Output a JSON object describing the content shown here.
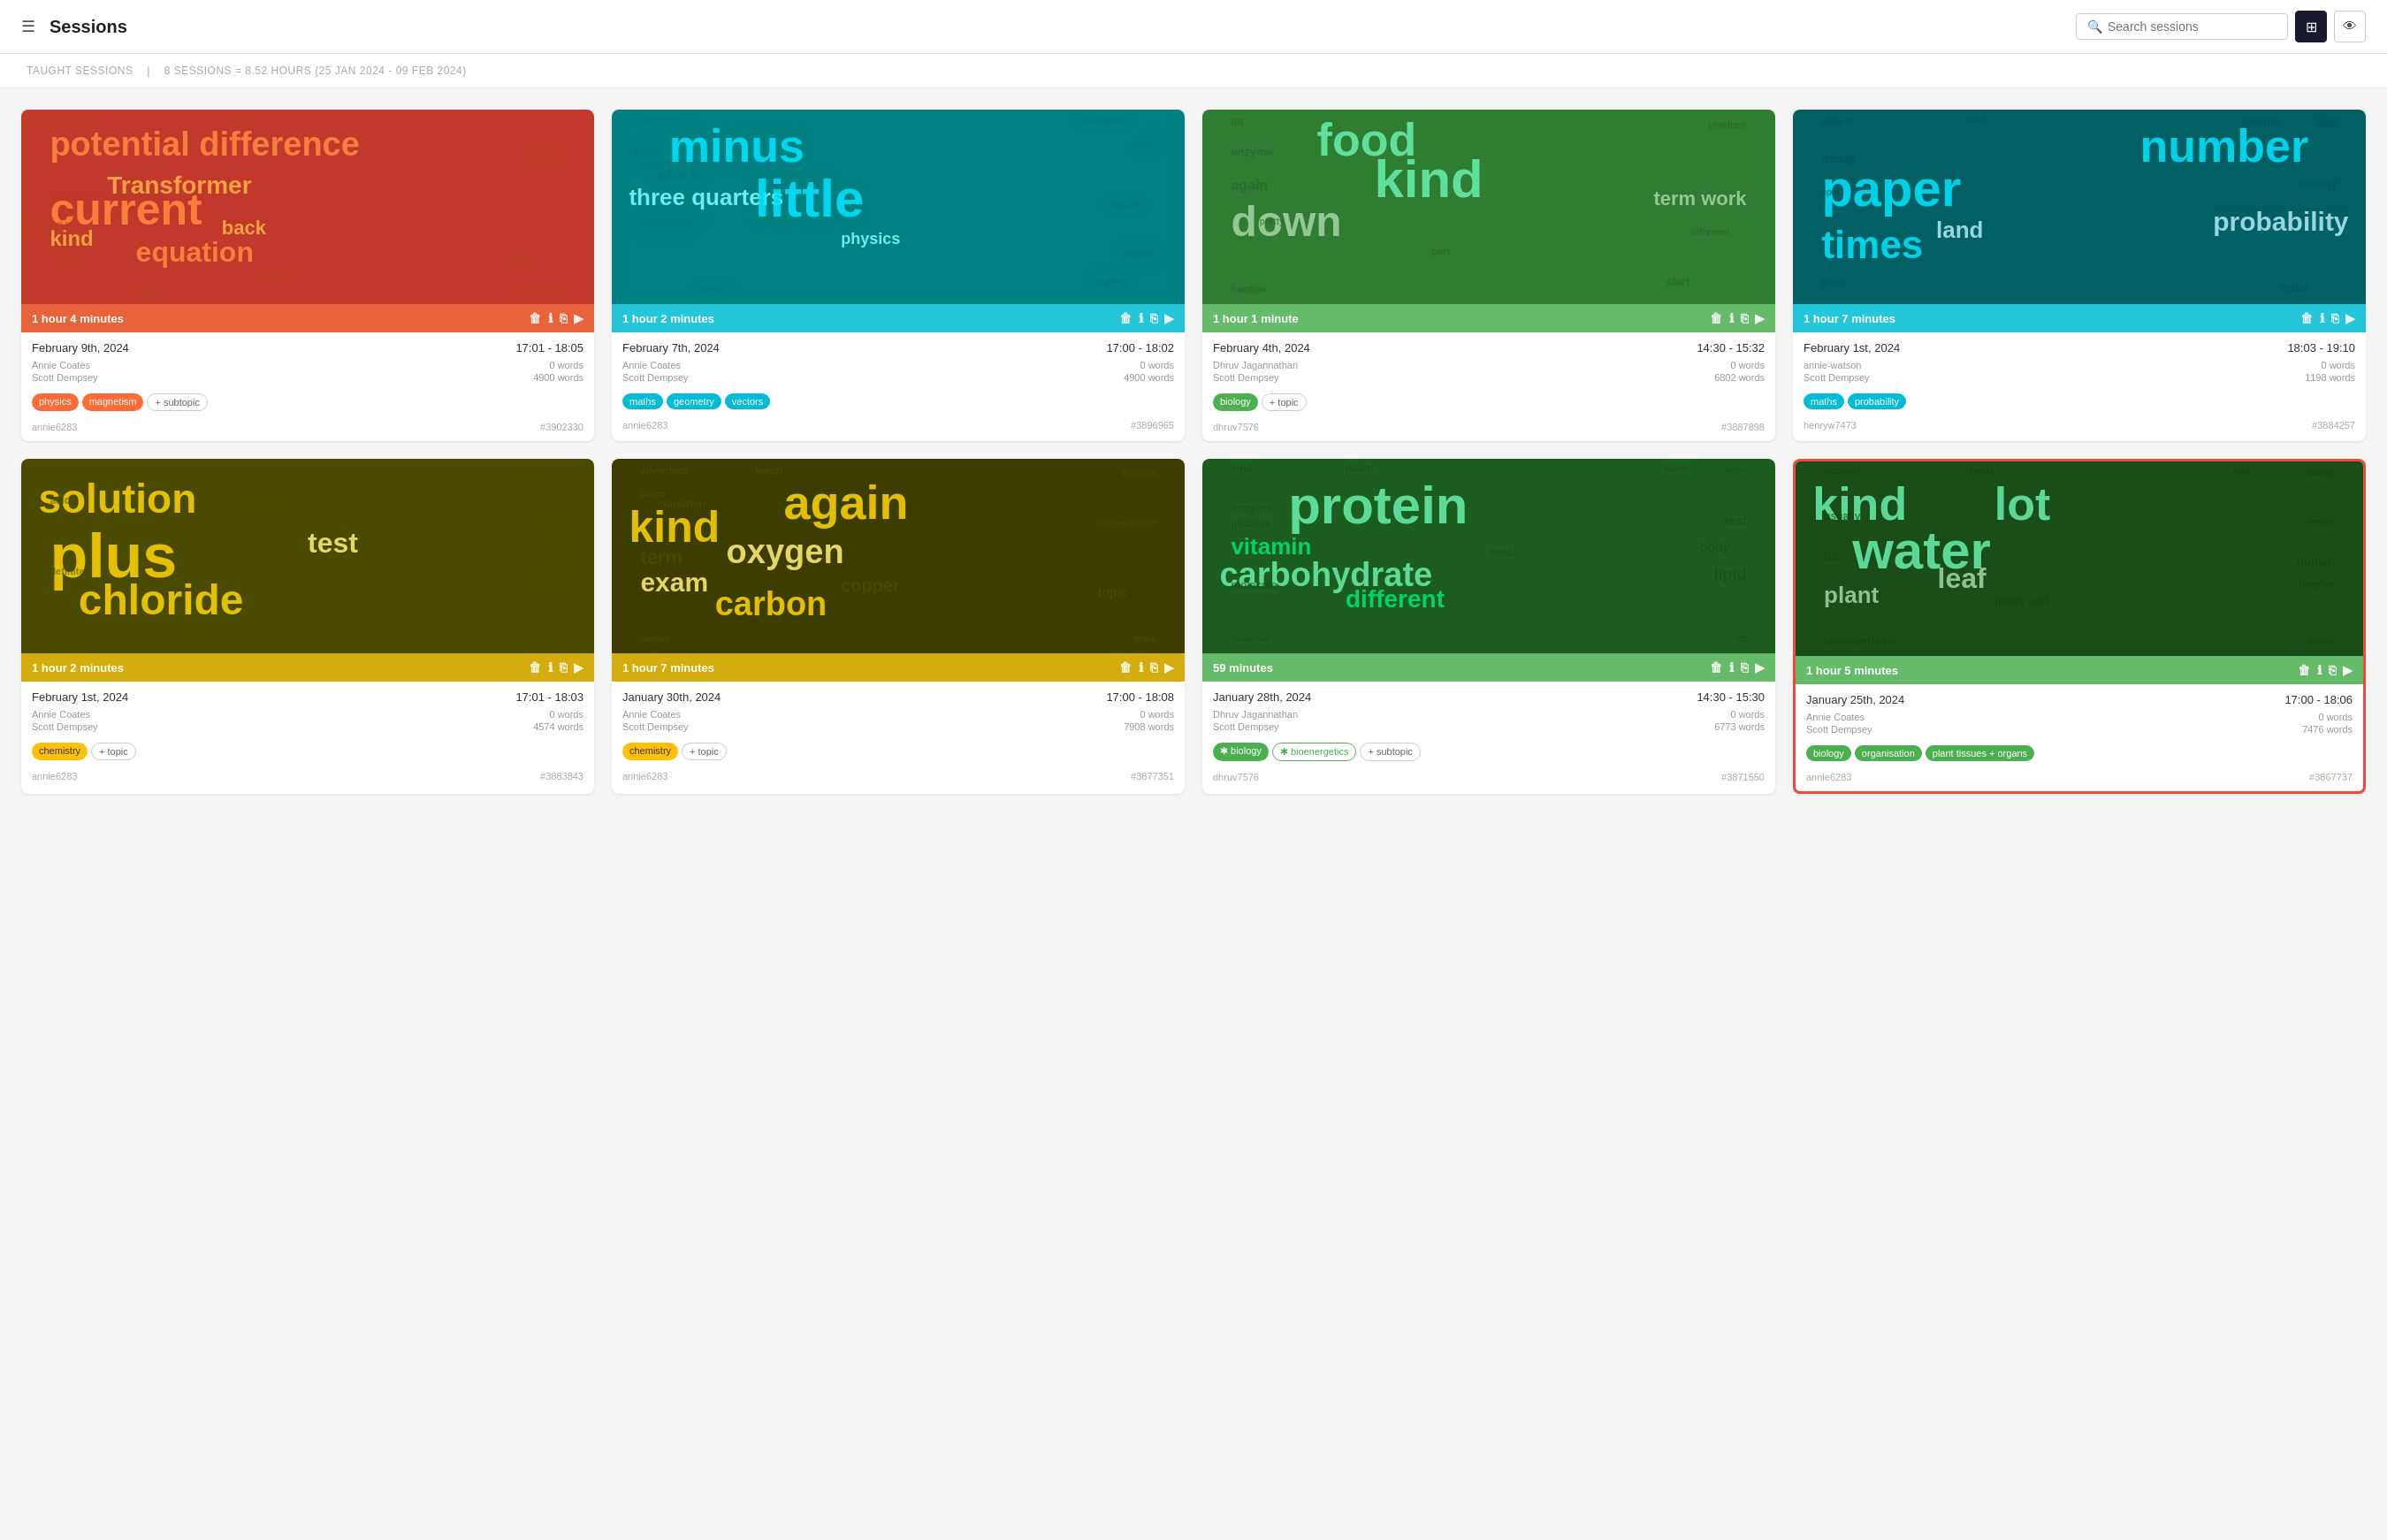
{
  "header": {
    "menu_label": "☰",
    "title": "Sessions",
    "search_placeholder": "Search sessions"
  },
  "subheader": {
    "label": "TAUGHT SESSIONS",
    "separator": "|",
    "stats": "8 SESSIONS = 8.52 HOURS (25 JAN 2024 - 09 FEB 2024)"
  },
  "sessions": [
    {
      "id": 1,
      "duration": "1 hour 4 minutes",
      "date": "February 9th, 2024",
      "time": "17:01 - 18:05",
      "teacher": "Annie Coates",
      "student": "Scott Dempsey",
      "teacher_words": "0 words",
      "student_words": "4900 words",
      "tags": [
        {
          "label": "physics",
          "type": "orange"
        },
        {
          "label": "magnetism",
          "type": "orange"
        },
        {
          "label": "+ subtopic",
          "type": "outline"
        }
      ],
      "user": "annie6283",
      "session_id": "#3902330",
      "wordcloud_theme": "orange",
      "main_words": [
        "potential difference",
        "current",
        "equation",
        "Transformer",
        "kind",
        "back",
        "mean",
        "work"
      ],
      "bar_color": "#e8623a"
    },
    {
      "id": 2,
      "duration": "1 hour 2 minutes",
      "date": "February 7th, 2024",
      "time": "17:00 - 18:02",
      "teacher": "Annie Coates",
      "student": "Scott Dempsey",
      "teacher_words": "0 words",
      "student_words": "4900 words",
      "tags": [
        {
          "label": "maths",
          "type": "teal"
        },
        {
          "label": "geometry",
          "type": "teal"
        },
        {
          "label": "vectors",
          "type": "teal"
        }
      ],
      "user": "annie6283",
      "session_id": "#3896965",
      "wordcloud_theme": "teal",
      "main_words": [
        "minus",
        "little",
        "three quarters"
      ],
      "bar_color": "#26c6da"
    },
    {
      "id": 3,
      "duration": "1 hour 1 minute",
      "date": "February 4th, 2024",
      "time": "14:30 - 15:32",
      "teacher": "Dhruv Jagannathan",
      "student": "Scott Dempsey",
      "teacher_words": "0 words",
      "student_words": "6802 words",
      "tags": [
        {
          "label": "biology",
          "type": "green"
        },
        {
          "label": "+ topic",
          "type": "outline"
        }
      ],
      "user": "dhruv7576",
      "session_id": "#3887898",
      "wordcloud_theme": "green",
      "main_words": [
        "food",
        "kind",
        "down",
        "term work",
        "lot"
      ],
      "bar_color": "#66bb6a"
    },
    {
      "id": 4,
      "duration": "1 hour 7 minutes",
      "date": "February 1st, 2024",
      "time": "18:03 - 19:10",
      "teacher": "annie-watson",
      "student": "Scott Dempsey",
      "teacher_words": "0 words",
      "student_words": "1198 words",
      "tags": [
        {
          "label": "maths",
          "type": "teal"
        },
        {
          "label": "probability",
          "type": "teal"
        }
      ],
      "user": "henryw7473",
      "session_id": "#3884257",
      "wordcloud_theme": "darkteal",
      "main_words": [
        "number",
        "paper",
        "times",
        "probability",
        "land"
      ],
      "bar_color": "#26c6da"
    },
    {
      "id": 5,
      "duration": "1 hour 2 minutes",
      "date": "February 1st, 2024",
      "time": "17:01 - 18:03",
      "teacher": "Annie Coates",
      "student": "Scott Dempsey",
      "teacher_words": "0 words",
      "student_words": "4574 words",
      "tags": [
        {
          "label": "chemistry",
          "type": "yellow"
        },
        {
          "label": "+ topic",
          "type": "outline"
        }
      ],
      "user": "annie6283",
      "session_id": "#3883843",
      "wordcloud_theme": "olive",
      "main_words": [
        "solution",
        "plus",
        "chloride",
        "ions",
        "test"
      ],
      "bar_color": "#d4ac0d"
    },
    {
      "id": 6,
      "duration": "1 hour 7 minutes",
      "date": "January 30th, 2024",
      "time": "17:00 - 18:08",
      "teacher": "Annie Coates",
      "student": "Scott Dempsey",
      "teacher_words": "0 words",
      "student_words": "7908 words",
      "tags": [
        {
          "label": "chemistry",
          "type": "yellow"
        },
        {
          "label": "+ topic",
          "type": "outline"
        }
      ],
      "user": "annie6283",
      "session_id": "#3877351",
      "wordcloud_theme": "yellowolive",
      "main_words": [
        "again",
        "kind",
        "oxygen",
        "exam",
        "carbon",
        "copper"
      ],
      "bar_color": "#d4ac0d"
    },
    {
      "id": 7,
      "duration": "59 minutes",
      "date": "January 28th, 2024",
      "time": "14:30 - 15:30",
      "teacher": "Dhruv Jagannathan",
      "student": "Scott Dempsey",
      "teacher_words": "0 words",
      "student_words": "6773 words",
      "tags": [
        {
          "label": "✱ biology",
          "type": "bio"
        },
        {
          "label": "✱ bioenergetics",
          "type": "bio-outline"
        },
        {
          "label": "+ subtopic",
          "type": "outline"
        }
      ],
      "user": "dhruv7576",
      "session_id": "#3871550",
      "wordcloud_theme": "darkgreen",
      "main_words": [
        "protein",
        "vitamin",
        "carbohydrate",
        "enzyme",
        "lipid",
        "different"
      ],
      "bar_color": "#66bb6a"
    },
    {
      "id": 8,
      "duration": "1 hour 5 minutes",
      "date": "January 25th, 2024",
      "time": "17:00 - 18:06",
      "teacher": "Annie Coates",
      "student": "Scott Dempsey",
      "teacher_words": "0 words",
      "student_words": "7476 words",
      "tags": [
        {
          "label": "biology",
          "type": "green"
        },
        {
          "label": "organisation",
          "type": "green"
        },
        {
          "label": "plant tissues + organs",
          "type": "green"
        }
      ],
      "user": "annie6283",
      "session_id": "#3867737",
      "wordcloud_theme": "darkgreen2",
      "main_words": [
        "kind",
        "lot",
        "water",
        "leaf",
        "plant",
        "soil"
      ],
      "highlighted": true,
      "bar_color": "#66bb6a"
    }
  ]
}
